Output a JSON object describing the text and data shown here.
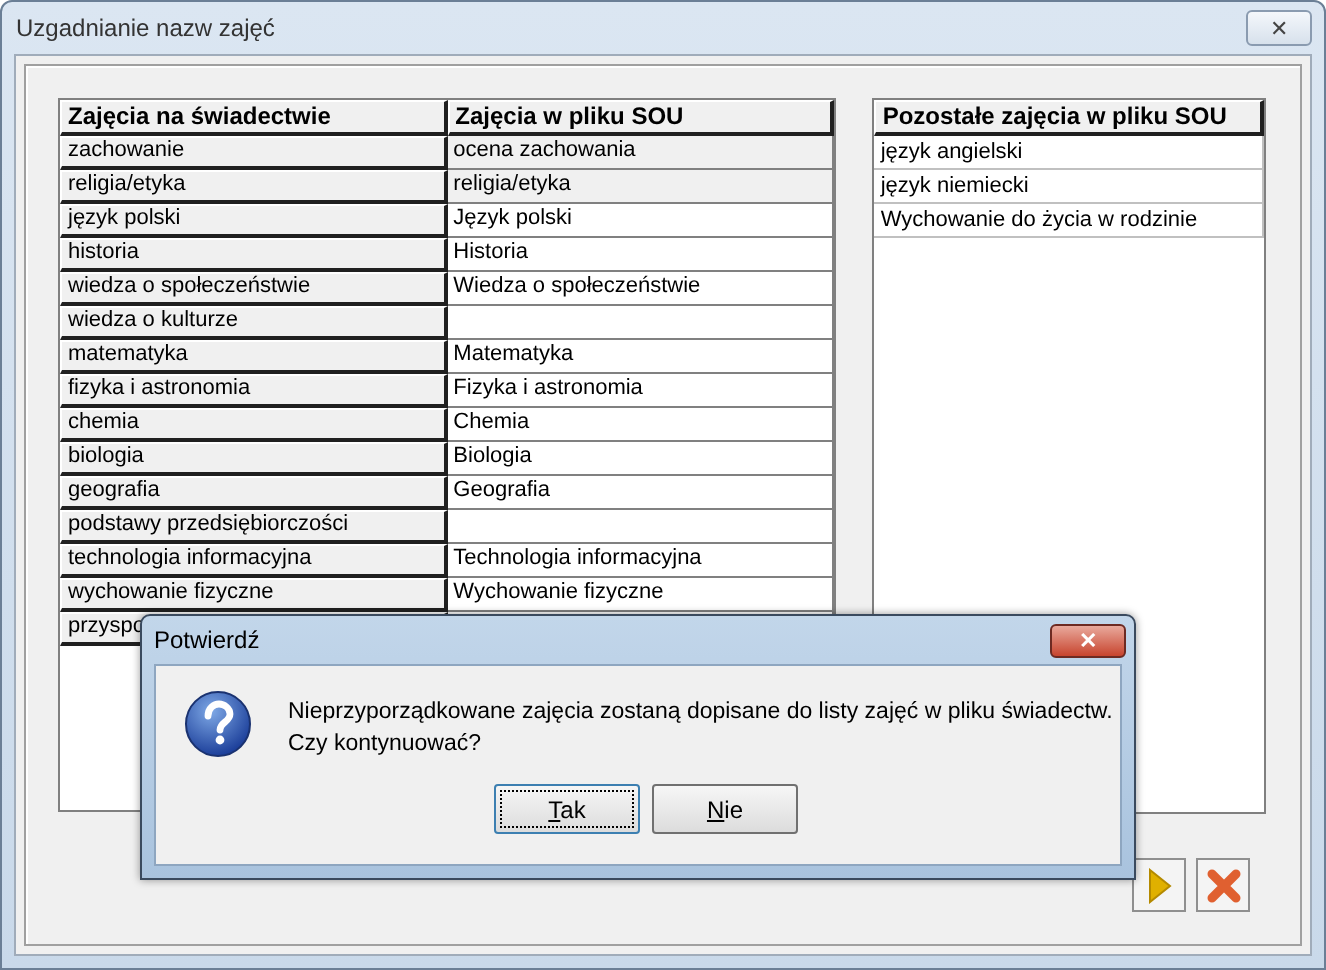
{
  "window": {
    "title": "Uzgadnianie nazw zajęć",
    "close": "✕"
  },
  "mapping_table": {
    "columns": [
      "Zajęcia na świadectwie",
      "Zajęcia w pliku SOU"
    ],
    "rows": [
      {
        "certificate": "zachowanie",
        "sou": "ocena zachowania",
        "shaded": true
      },
      {
        "certificate": "religia/etyka",
        "sou": "religia/etyka",
        "shaded": true
      },
      {
        "certificate": "język polski",
        "sou": "Język polski",
        "shaded": false
      },
      {
        "certificate": "historia",
        "sou": "Historia",
        "shaded": false
      },
      {
        "certificate": "wiedza o społeczeństwie",
        "sou": "Wiedza o społeczeństwie",
        "shaded": false
      },
      {
        "certificate": "wiedza o kulturze",
        "sou": "",
        "shaded": false
      },
      {
        "certificate": "matematyka",
        "sou": "Matematyka",
        "shaded": false
      },
      {
        "certificate": "fizyka i astronomia",
        "sou": "Fizyka i astronomia",
        "shaded": false
      },
      {
        "certificate": "chemia",
        "sou": "Chemia",
        "shaded": false
      },
      {
        "certificate": "biologia",
        "sou": "Biologia",
        "shaded": false
      },
      {
        "certificate": "geografia",
        "sou": "Geografia",
        "shaded": false
      },
      {
        "certificate": "podstawy przedsiębiorczości",
        "sou": "",
        "shaded": false
      },
      {
        "certificate": "technologia informacyjna",
        "sou": "Technologia informacyjna",
        "shaded": false
      },
      {
        "certificate": "wychowanie fizyczne",
        "sou": "Wychowanie fizyczne",
        "shaded": false
      },
      {
        "certificate": "przyspo",
        "sou": "",
        "shaded": false
      }
    ]
  },
  "remaining_list": {
    "column": "Pozostałe zajęcia w pliku SOU",
    "items": [
      "język angielski",
      "język niemiecki",
      "Wychowanie do życia w rodzinie"
    ]
  },
  "dialog": {
    "title": "Potwierdź",
    "close": "✕",
    "message": "Nieprzyporządkowane zajęcia zostaną dopisane do listy zajęć w pliku świadectw.\nCzy kontynuować?",
    "buttons": [
      {
        "label": "Tak",
        "focused": true
      },
      {
        "label": "Nie",
        "focused": false
      }
    ]
  }
}
